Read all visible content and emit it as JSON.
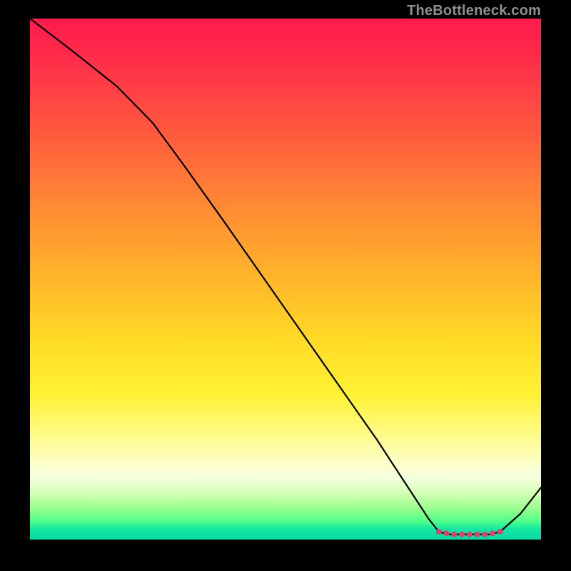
{
  "watermark": "TheBottleneck.com",
  "chart_data": {
    "type": "line",
    "title": "",
    "xlabel": "",
    "ylabel": "",
    "xlim": [
      0,
      1
    ],
    "ylim": [
      0,
      1
    ],
    "series": [
      {
        "name": "bottleneck-curve",
        "x": [
          0.0,
          0.08,
          0.17,
          0.24,
          0.3,
          0.38,
          0.48,
          0.58,
          0.68,
          0.74,
          0.78,
          0.8,
          0.82,
          0.84,
          0.86,
          0.88,
          0.9,
          0.92,
          0.96,
          1.0
        ],
        "y": [
          1.0,
          0.94,
          0.87,
          0.8,
          0.72,
          0.61,
          0.47,
          0.33,
          0.19,
          0.1,
          0.04,
          0.015,
          0.01,
          0.01,
          0.01,
          0.01,
          0.01,
          0.015,
          0.05,
          0.1
        ]
      }
    ],
    "markers": {
      "name": "optimal-range",
      "x": [
        0.8,
        0.815,
        0.83,
        0.845,
        0.86,
        0.875,
        0.89,
        0.905,
        0.92
      ],
      "y": [
        0.015,
        0.012,
        0.01,
        0.01,
        0.01,
        0.01,
        0.01,
        0.012,
        0.015
      ],
      "color": "#d9436b"
    },
    "gradient_colors": {
      "top": "#ff1a4d",
      "mid_upper": "#ff8a33",
      "mid": "#ffdb26",
      "mid_lower": "#fffb8a",
      "bottom": "#0ad8a4"
    }
  }
}
